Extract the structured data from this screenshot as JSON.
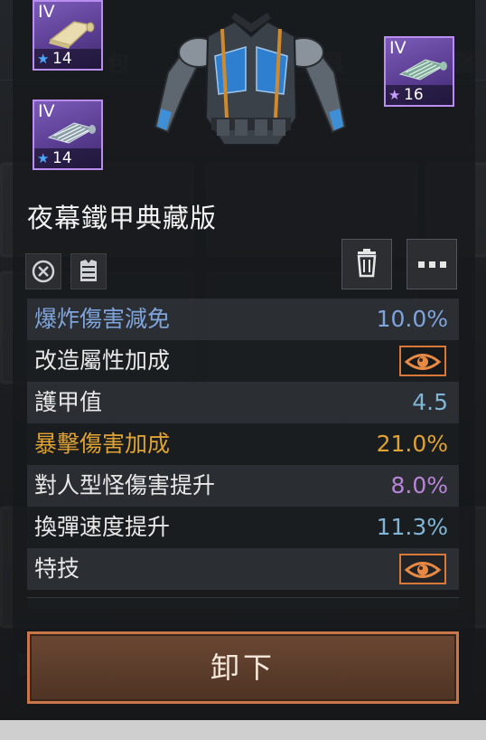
{
  "materials": [
    {
      "tier": "IV",
      "count": "14",
      "star": "★",
      "star_color": "#4aa8ff",
      "icon": "cloth-roll-icon"
    },
    {
      "tier": "IV",
      "count": "16",
      "star": "★",
      "star_color": "#c79cff",
      "icon": "chain-mesh-icon"
    },
    {
      "tier": "IV",
      "count": "14",
      "star": "★",
      "star_color": "#4aa8ff",
      "icon": "chain-mesh-icon"
    }
  ],
  "item": {
    "name": "夜幕鐵甲典藏版",
    "image": "armor-vest-icon"
  },
  "icons": {
    "cancel": "cancel-icon",
    "armor_type": "armor-type-icon",
    "delete": "trash-icon",
    "more": "more-icon"
  },
  "stats": [
    {
      "name": "爆炸傷害減免",
      "value": "10.0%",
      "name_color": "#7fa4dc",
      "value_color": "#7fa4dc"
    },
    {
      "name": "改造屬性加成",
      "value": "",
      "eye": true,
      "name_color": "#e8e8e8"
    },
    {
      "name": "護甲值",
      "value": "4.5",
      "name_color": "#e8e8e8",
      "value_color": "#7fb6d8"
    },
    {
      "name": "暴擊傷害加成",
      "value": "21.0%",
      "name_color": "#e0a233",
      "value_color": "#e0a233"
    },
    {
      "name": "對人型怪傷害提升",
      "value": "8.0%",
      "name_color": "#e8e8e8",
      "value_color": "#b984d8"
    },
    {
      "name": "換彈速度提升",
      "value": "11.3%",
      "name_color": "#e8e8e8",
      "value_color": "#7fb6d8"
    },
    {
      "name": "特技",
      "value": "",
      "eye": true,
      "name_color": "#e8e8e8"
    }
  ],
  "unload_button": "卸下",
  "colors": {
    "accent_orange": "#d8793a",
    "card_purple": "#b98ef0"
  }
}
